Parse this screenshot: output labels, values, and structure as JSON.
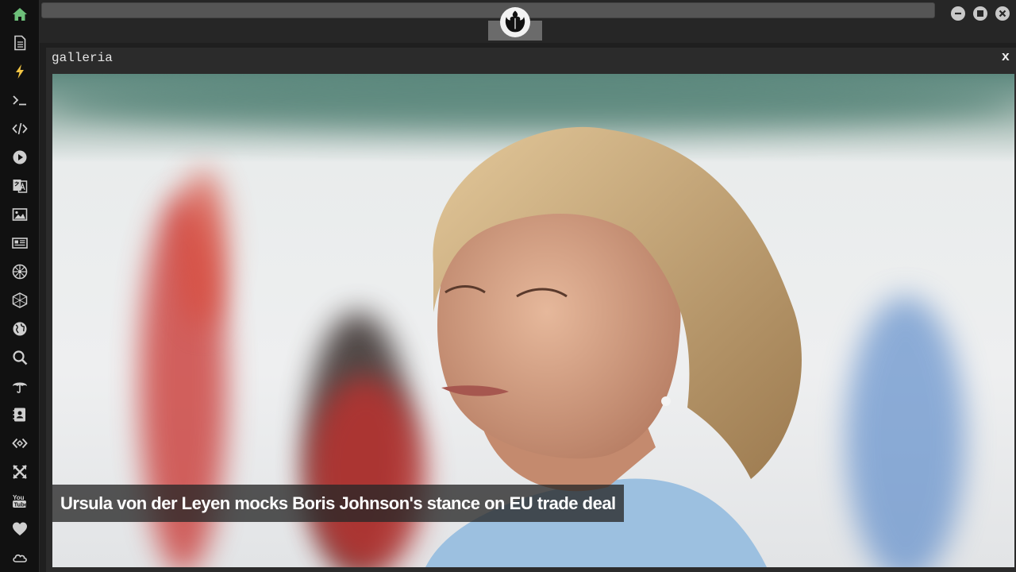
{
  "sidebar": {
    "items": [
      {
        "name": "home-icon",
        "color": "#6ec07a"
      },
      {
        "name": "document-icon",
        "color": "#cfcfcf"
      },
      {
        "name": "lightning-icon",
        "color": "#f2c544"
      },
      {
        "name": "terminal-icon",
        "color": "#cfcfcf"
      },
      {
        "name": "code-icon",
        "color": "#cfcfcf"
      },
      {
        "name": "play-icon",
        "color": "#cfcfcf"
      },
      {
        "name": "translate-icon",
        "color": "#cfcfcf"
      },
      {
        "name": "image-icon",
        "color": "#cfcfcf"
      },
      {
        "name": "newspaper-icon",
        "color": "#cfcfcf"
      },
      {
        "name": "emblem-icon",
        "color": "#cfcfcf"
      },
      {
        "name": "hexagon-icon",
        "color": "#cfcfcf"
      },
      {
        "name": "globe-icon",
        "color": "#cfcfcf"
      },
      {
        "name": "search-icon",
        "color": "#cfcfcf"
      },
      {
        "name": "umbrella-icon",
        "color": "#cfcfcf"
      },
      {
        "name": "contact-book-icon",
        "color": "#cfcfcf"
      },
      {
        "name": "link-icon",
        "color": "#cfcfcf"
      },
      {
        "name": "expand-icon",
        "color": "#cfcfcf"
      },
      {
        "name": "youtube-icon",
        "color": "#cfcfcf"
      },
      {
        "name": "heart-icon",
        "color": "#cfcfcf"
      },
      {
        "name": "cloud-icon",
        "color": "#cfcfcf"
      }
    ]
  },
  "topbar": {
    "emblem": "rebel-alliance-emblem",
    "window_buttons": [
      "minimize-icon",
      "maximize-icon",
      "close-icon"
    ]
  },
  "panel": {
    "title": "galleria",
    "close_label": "x",
    "caption": "Ursula von der Leyen mocks Boris Johnson's stance on EU trade deal"
  }
}
